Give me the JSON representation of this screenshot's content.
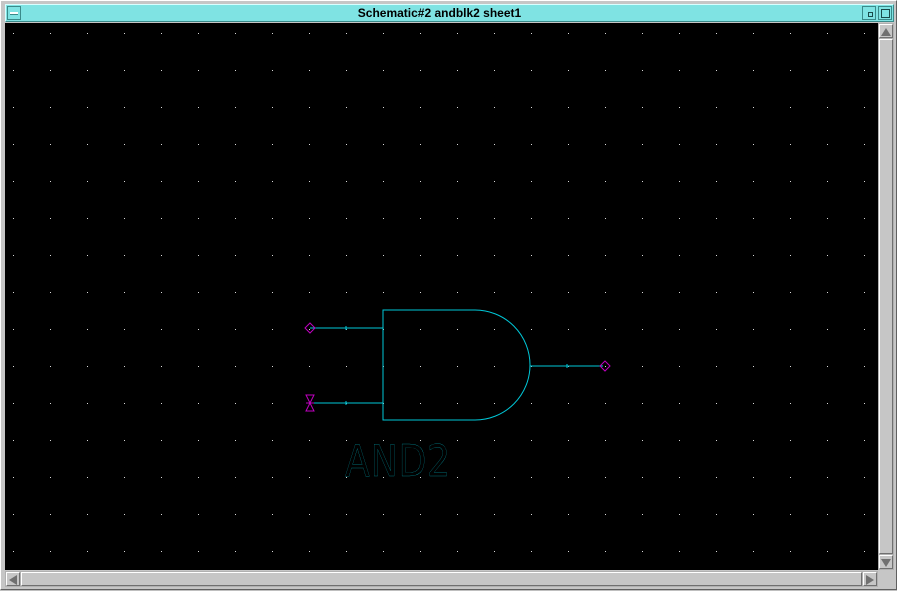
{
  "window": {
    "title": "Schematic#2 andblk2 sheet1"
  },
  "schematic": {
    "symbol_label": "AND2",
    "colors": {
      "background": "#000000",
      "grid_dot": "#d8d8d8",
      "wire": "#00c8d8",
      "pin_marker": "#c000c0",
      "label": "#00c8d8"
    },
    "icons": {
      "input_pin_a": "diamond-pin-icon",
      "input_pin_b": "bidirectional-pin-icon",
      "output_pin": "diamond-pin-icon"
    }
  }
}
